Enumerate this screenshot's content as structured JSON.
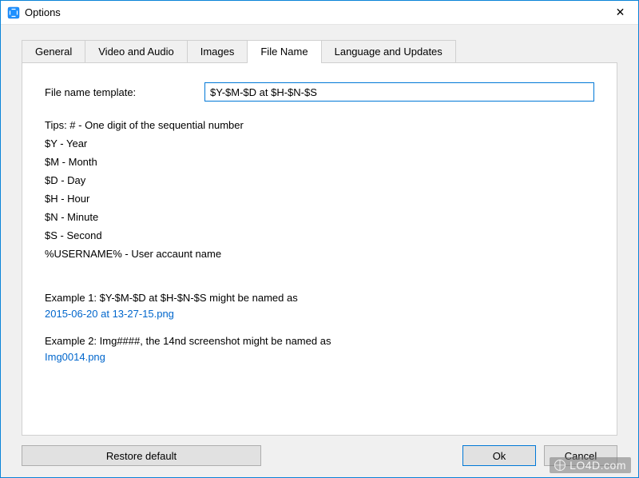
{
  "window": {
    "title": "Options"
  },
  "tabs": {
    "general": "General",
    "video_audio": "Video and Audio",
    "images": "Images",
    "file_name": "File Name",
    "lang_updates": "Language and Updates"
  },
  "filename": {
    "label": "File name template:",
    "value": "$Y-$M-$D at $H-$N-$S"
  },
  "tips": {
    "heading": "Tips: # - One digit of the sequential number",
    "y": "$Y - Year",
    "m": "$M - Month",
    "d": "$D - Day",
    "h": "$H - Hour",
    "n": "$N - Minute",
    "s": "$S - Second",
    "user": "%USERNAME% - User accaunt name"
  },
  "examples": {
    "ex1_line1": "Example 1: $Y-$M-$D at $H-$N-$S might be named as",
    "ex1_line2": "2015-06-20 at 13-27-15.png",
    "ex2_line1": "Example 2: Img####, the 14nd screenshot might be named as",
    "ex2_line2": "Img0014.png"
  },
  "buttons": {
    "restore": "Restore default",
    "ok": "Ok",
    "cancel": "Cancel"
  },
  "watermark": "LO4D.com"
}
